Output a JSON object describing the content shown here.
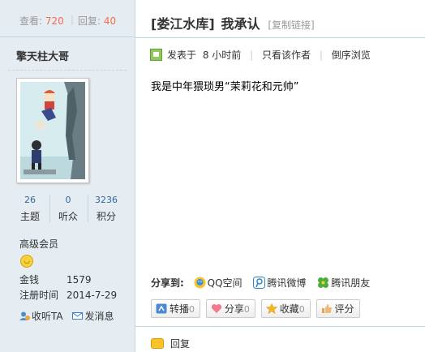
{
  "stats": {
    "views_label": "查看:",
    "views": "720",
    "replies_label": "回复:",
    "replies": "40"
  },
  "author": {
    "name": "擎天柱大哥",
    "counts": [
      {
        "value": "26",
        "label": "主题"
      },
      {
        "value": "0",
        "label": "听众"
      },
      {
        "value": "3236",
        "label": "积分"
      }
    ],
    "group": "高级会员",
    "money_label": "金钱",
    "money": "1579",
    "reg_label": "注册时间",
    "reg_date": "2014-7-29",
    "follow_link": "收听TA",
    "message_link": "发消息"
  },
  "post": {
    "forum": "[娄江水库]",
    "title": "我承认",
    "copy_link": "[复制链接]",
    "posted_label": "发表于",
    "posted_time": "8 小时前",
    "only_author": "只看该作者",
    "reverse": "倒序浏览",
    "content": "我是中年猥琐男“茉莉花和元帅”"
  },
  "share": {
    "label": "分享到:",
    "items": [
      "QQ空间",
      "腾讯微博",
      "腾讯朋友"
    ]
  },
  "actions": [
    {
      "label": "转播",
      "count": "0"
    },
    {
      "label": "分享",
      "count": "0"
    },
    {
      "label": "收藏",
      "count": "0"
    },
    {
      "label": "评分",
      "count": ""
    }
  ],
  "reply_label": "回复",
  "colors": {
    "sidebar_bg": "#e5edf2",
    "border": "#c2d5e3",
    "accent_number": "#f26c4f",
    "link_blue": "#336699"
  },
  "icons": [
    "online-icon",
    "qzone-icon",
    "tweibo-icon",
    "tfriend-icon",
    "relay-icon",
    "heart-icon",
    "star-icon",
    "thumb-icon",
    "reply-icon",
    "smile-icon",
    "follow-icon",
    "mail-icon"
  ]
}
